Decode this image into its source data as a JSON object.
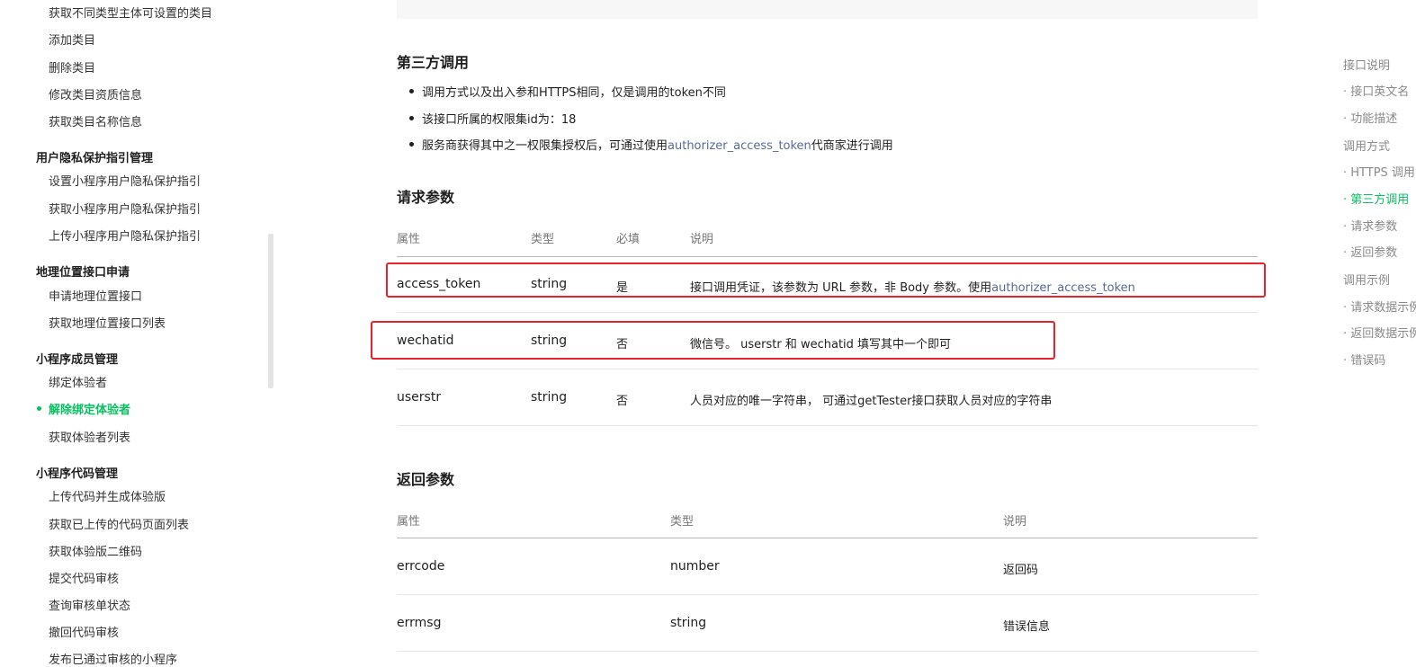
{
  "sidebar": {
    "groups": [
      {
        "title": "",
        "items": [
          "获取不同类型主体可设置的类目",
          "添加类目",
          "删除类目",
          "修改类目资质信息",
          "获取类目名称信息"
        ]
      },
      {
        "title": "用户隐私保护指引管理",
        "items": [
          "设置小程序用户隐私保护指引",
          "获取小程序用户隐私保护指引",
          "上传小程序用户隐私保护指引"
        ]
      },
      {
        "title": "地理位置接口申请",
        "items": [
          "申请地理位置接口",
          "获取地理位置接口列表"
        ]
      },
      {
        "title": "小程序成员管理",
        "items": [
          "绑定体验者",
          "解除绑定体验者",
          "获取体验者列表"
        ]
      },
      {
        "title": "小程序代码管理",
        "items": [
          "上传代码并生成体验版",
          "获取已上传的代码页面列表",
          "获取体验版二维码",
          "提交代码审核",
          "查询审核单状态",
          "撤回代码审核",
          "发布已通过审核的小程序"
        ]
      }
    ],
    "active_item": "解除绑定体验者"
  },
  "third_party": {
    "title": "第三方调用",
    "bullets": [
      {
        "text": "调用方式以及出入参和HTTPS相同，仅是调用的token不同"
      },
      {
        "text": "该接口所属的权限集id为：18"
      },
      {
        "text_before": "服务商获得其中之一权限集授权后，可通过使用",
        "link": "authorizer_access_token",
        "text_after": "代商家进行调用"
      }
    ]
  },
  "request_params": {
    "title": "请求参数",
    "headers": [
      "属性",
      "类型",
      "必填",
      "说明"
    ],
    "rows": [
      {
        "name": "access_token",
        "type": "string",
        "required": "是",
        "desc": "接口调用凭证，该参数为 URL 参数，非 Body 参数。使用",
        "desc_link": "authorizer_access_token"
      },
      {
        "name": "wechatid",
        "type": "string",
        "required": "否",
        "desc": "微信号。 userstr 和 wechatid 填写其中一个即可",
        "desc_link": ""
      },
      {
        "name": "userstr",
        "type": "string",
        "required": "否",
        "desc": "人员对应的唯一字符串， 可通过getTester接口获取人员对应的字符串",
        "desc_link": ""
      }
    ]
  },
  "return_params": {
    "title": "返回参数",
    "headers": [
      "属性",
      "类型",
      "说明"
    ],
    "rows": [
      {
        "name": "errcode",
        "type": "number",
        "desc": "返回码"
      },
      {
        "name": "errmsg",
        "type": "string",
        "desc": "错误信息"
      }
    ]
  },
  "toc": {
    "items": [
      {
        "label": "接口说明",
        "level": 1
      },
      {
        "label": "· 接口英文名",
        "level": 2
      },
      {
        "label": "· 功能描述",
        "level": 2
      },
      {
        "label": "调用方式",
        "level": 1
      },
      {
        "label": "· HTTPS 调用",
        "level": 2
      },
      {
        "label": "· 第三方调用",
        "level": 2
      },
      {
        "label": "· 请求参数",
        "level": 2
      },
      {
        "label": "· 返回参数",
        "level": 2
      },
      {
        "label": "调用示例",
        "level": 1
      },
      {
        "label": "· 请求数据示例",
        "level": 2
      },
      {
        "label": "· 返回数据示例",
        "level": 2
      },
      {
        "label": "· 错误码",
        "level": 2
      }
    ],
    "active_label": "· 第三方调用"
  },
  "colors": {
    "accent": "#07c160",
    "link": "#576b95",
    "highlight_box": "#e8232b"
  }
}
